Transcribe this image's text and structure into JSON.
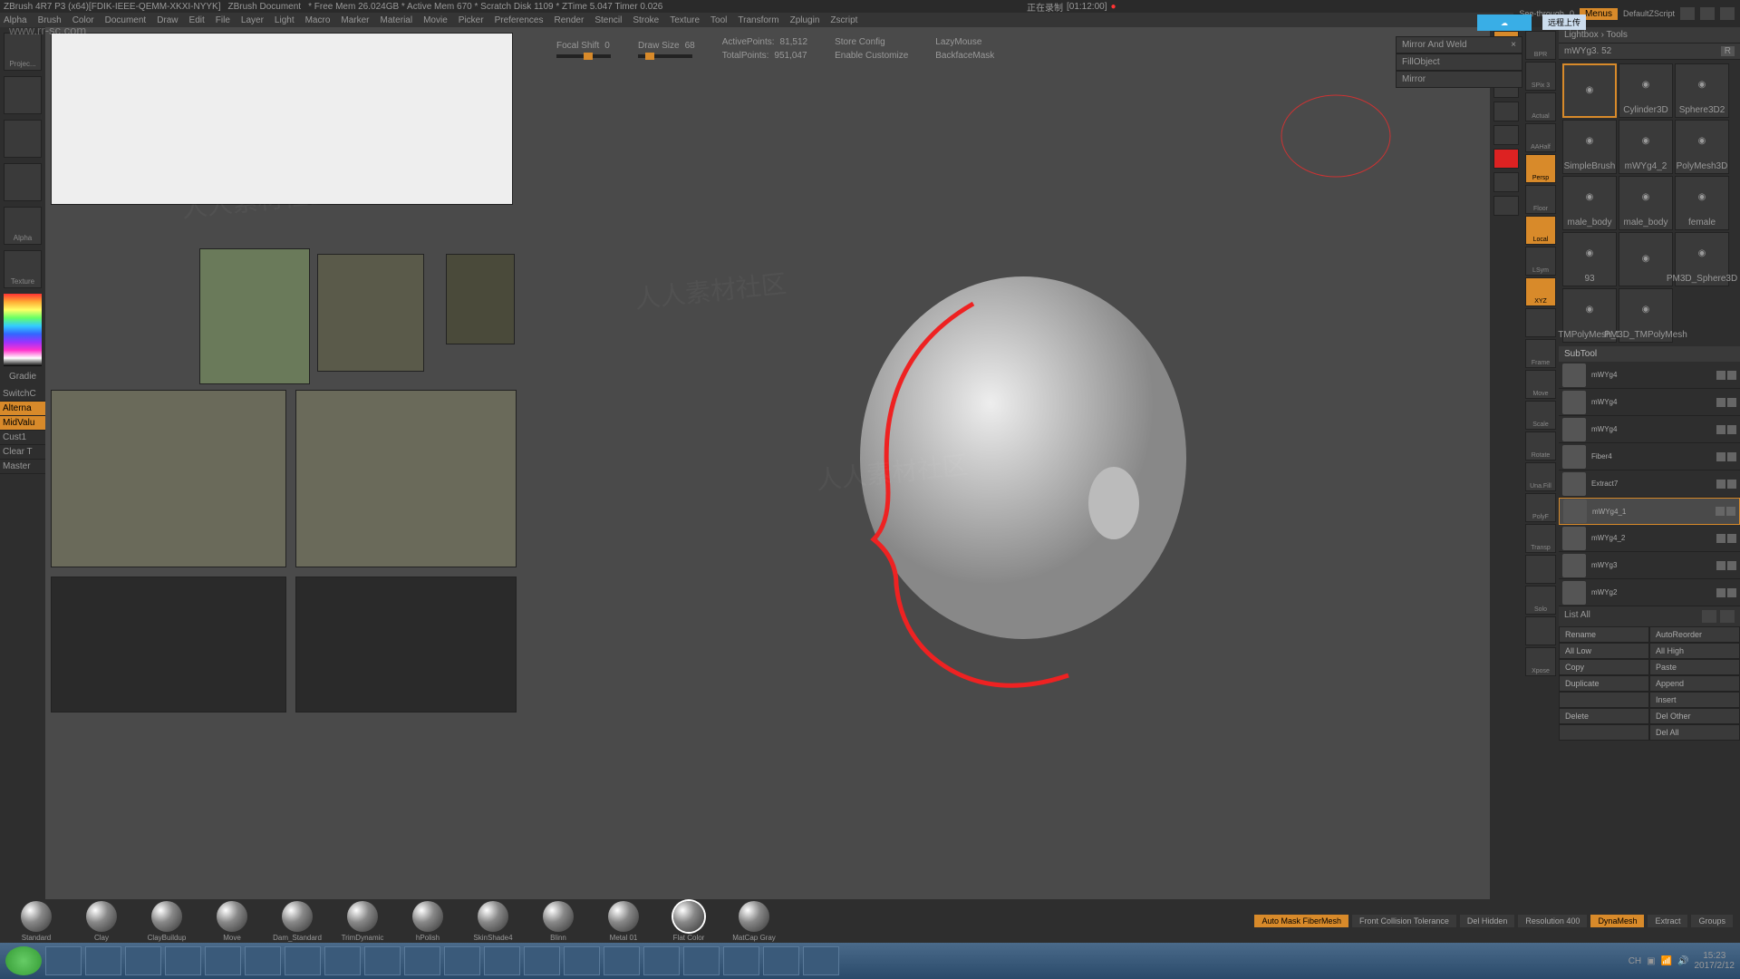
{
  "title": {
    "app": "ZBrush 4R7 P3 (x64)[FDIK-IEEE-QEMM-XKXI-NYYK]",
    "doc": "ZBrush Document",
    "mem": "* Free Mem 26.024GB * Active Mem 670 * Scratch Disk 1109 * ZTime 5.047 Timer 0.026"
  },
  "menu": [
    "Alpha",
    "Brush",
    "Color",
    "Document",
    "Draw",
    "Edit",
    "File",
    "Layer",
    "Light",
    "Macro",
    "Marker",
    "Material",
    "Movie",
    "Picker",
    "Preferences",
    "Render",
    "Stencil",
    "Stroke",
    "Texture",
    "Tool",
    "Transform",
    "Zplugin",
    "Zscript"
  ],
  "topright": {
    "see": "See-through",
    "seeval": "0",
    "menus": "Menus",
    "script": "DefaultZScript"
  },
  "recording": {
    "label": "正在录制",
    "time": "[01:12:00]"
  },
  "cloud_tooltip": "远程上传",
  "url_wm": "www.rr-sc.com",
  "canvas_params": {
    "focal_shift": {
      "label": "Focal Shift",
      "value": "0"
    },
    "draw_size": {
      "label": "Draw Size",
      "value": "68"
    },
    "active_pts": {
      "label": "ActivePoints:",
      "value": "81,512"
    },
    "total_pts": {
      "label": "TotalPoints:",
      "value": "951,047"
    },
    "store": "Store Config",
    "enable": "Enable Customize",
    "lazy": "LazyMouse",
    "backface": "BackfaceMask"
  },
  "floating": {
    "mirror_weld": "Mirror And Weld",
    "fill": "FillObject",
    "mirror": "Mirror"
  },
  "left_slots": [
    "Projec...",
    "",
    "",
    "",
    "Alpha",
    "Texture"
  ],
  "left_grad_label": "Gradie",
  "left_opts": {
    "switch": "SwitchC",
    "alt": "Alterna",
    "mid": "MidValu",
    "cust": "Cust1",
    "clear": "Clear T",
    "master": "Master"
  },
  "nav_buttons": [
    "BPR",
    "SPix 3",
    "Actual",
    "AAHalf",
    "Persp",
    "Floor",
    "Local",
    "LSym",
    "XYZ",
    "",
    "Frame",
    "Move",
    "Scale",
    "Rotate",
    "Una.Fill",
    "PolyF",
    "Transp",
    "",
    "Solo",
    "",
    "Xpose"
  ],
  "nav_orange": [
    "Persp",
    "Local",
    "XYZ"
  ],
  "right": {
    "lightbox": "Lightbox › Tools",
    "current_tool": "mWYg3. 52",
    "tools": [
      "",
      "Cylinder3D",
      "Sphere3D2",
      "SimpleBrush",
      "mWYg4_2",
      "PolyMesh3D",
      "male_body",
      "male_body",
      "female",
      "93",
      "",
      "PM3D_Sphere3D",
      "TMPolyMesh_1",
      "PM3D_TMPolyMesh"
    ],
    "subtool_header": "SubTool",
    "subtools": [
      {
        "name": "mWYg4",
        "sel": false
      },
      {
        "name": "mWYg4",
        "sel": false
      },
      {
        "name": "mWYg4",
        "sel": false
      },
      {
        "name": "Fiber4",
        "sel": false
      },
      {
        "name": "Extract7",
        "sel": false
      },
      {
        "name": "mWYg4_1",
        "sel": true
      },
      {
        "name": "mWYg4_2",
        "sel": false
      },
      {
        "name": "mWYg3",
        "sel": false
      },
      {
        "name": "mWYg2",
        "sel": false
      }
    ],
    "visible": "visible",
    "listall": "List All",
    "btns": [
      [
        "Rename",
        "AutoReorder"
      ],
      [
        "All Low",
        "All High"
      ],
      [
        "Copy",
        "Paste"
      ],
      [
        "Duplicate",
        "Append"
      ],
      [
        "",
        "Insert"
      ],
      [
        "Delete",
        "Del Other"
      ],
      [
        "",
        "Del All"
      ]
    ]
  },
  "brushes": [
    "Standard",
    "Clay",
    "ClayBuildup",
    "Move",
    "Dam_Standard",
    "TrimDynamic",
    "hPolish",
    "SkinShade4",
    "Blinn",
    "Metal 01",
    "Flat Color",
    "MatCap Gray"
  ],
  "brush_sel": "Flat Color",
  "bottom_opts": {
    "auto": "Auto Mask FiberMesh",
    "front": "Front Collision Tolerance",
    "del": "Del Hidden",
    "res": "Resolution 400",
    "dyna": "DynaMesh",
    "extract": "Extract",
    "groups": "Groups"
  },
  "tray": {
    "ime": "CH",
    "time": "15:23",
    "date": "2017/2/12"
  }
}
